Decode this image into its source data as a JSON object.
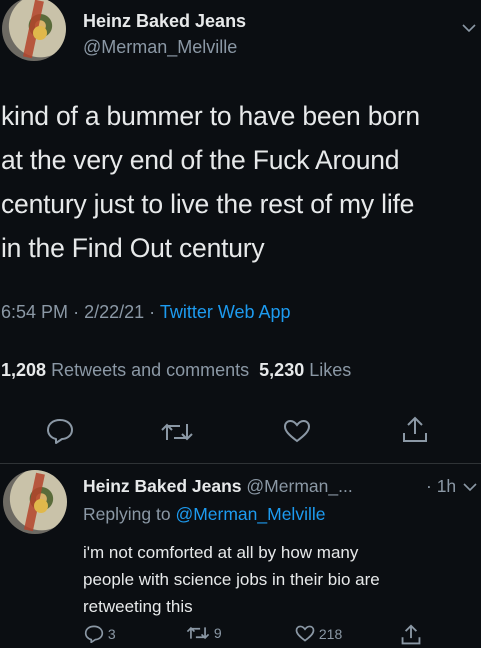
{
  "main_tweet": {
    "display_name": "Heinz Baked Jeans",
    "handle": "@Merman_Melville",
    "chevron_icon": "chevron-down-icon",
    "text_lines": [
      "kind of a bummer to have been born",
      "at the very end of the Fuck Around",
      "century just to live the rest of my life",
      "in the Find Out century"
    ],
    "time": "6:54 PM",
    "date": "2/22/21",
    "separator": "·",
    "source": "Twitter Web App",
    "retweets_count": "1,208",
    "retweets_label": "Retweets and comments",
    "likes_count": "5,230",
    "likes_label": "Likes",
    "actions": [
      "reply-icon",
      "retweet-icon",
      "like-icon",
      "share-icon"
    ]
  },
  "reply": {
    "display_name": "Heinz Baked Jeans",
    "handle": "@Merman_...",
    "time": "· 1h",
    "replying_to_label": "Replying to",
    "replying_to_handle": "@Merman_Melville",
    "text_lines": [
      "i'm not comforted at all by how many",
      "people with science jobs in their bio are",
      "retweeting this"
    ],
    "reply_count": "3",
    "retweet_count": "9",
    "like_count": "218"
  },
  "colors": {
    "background": "#0b0e12",
    "text": "#e7e9ea",
    "muted": "#8b98a5",
    "link": "#1d9bf0"
  }
}
